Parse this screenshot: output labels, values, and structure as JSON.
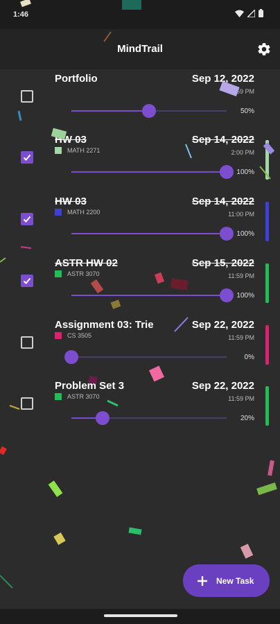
{
  "status": {
    "time": "1:46"
  },
  "app": {
    "title": "MindTrail"
  },
  "tasks": [
    {
      "name": "Portfolio",
      "date": "Sep 12, 2022",
      "course": "",
      "course_color": "",
      "time": "11:59 PM",
      "percent_label": "50%",
      "progress": 0.5,
      "done": false,
      "bar_color": ""
    },
    {
      "name": "HW 03",
      "date": "Sep 14, 2022",
      "course": "MATH 2271",
      "course_color": "#a5d6a7",
      "time": "2:00 PM",
      "percent_label": "100%",
      "progress": 1.0,
      "done": true,
      "bar_color": "#a5d6a7"
    },
    {
      "name": "HW 03",
      "date": "Sep 14, 2022",
      "course": "MATH 2200",
      "course_color": "#3f3fdc",
      "time": "11:00 PM",
      "percent_label": "100%",
      "progress": 1.0,
      "done": true,
      "bar_color": "#3f3fdc"
    },
    {
      "name": "ASTR HW 02",
      "date": "Sep 15, 2022",
      "course": "ASTR 3070",
      "course_color": "#1fbf55",
      "time": "11:59 PM",
      "percent_label": "100%",
      "progress": 1.0,
      "done": true,
      "bar_color": "#1fbf55"
    },
    {
      "name": "Assignment 03: Trie",
      "date": "Sep 22, 2022",
      "course": "CS 3505",
      "course_color": "#e0206f",
      "time": "11:59 PM",
      "percent_label": "0%",
      "progress": 0.0,
      "done": false,
      "bar_color": "#e0206f"
    },
    {
      "name": "Problem Set 3",
      "date": "Sep 22, 2022",
      "course": "ASTR 3070",
      "course_color": "#1fbf55",
      "time": "11:59 PM",
      "percent_label": "20%",
      "progress": 0.2,
      "done": false,
      "bar_color": "#1fbf55"
    }
  ],
  "fab": {
    "label": "New Task"
  },
  "icons": {
    "settings": "gear-icon",
    "add": "plus-icon",
    "check": "check-icon"
  },
  "colors": {
    "accent": "#7c4dcf",
    "background": "#2c2c2c",
    "app_bar": "#242424"
  }
}
